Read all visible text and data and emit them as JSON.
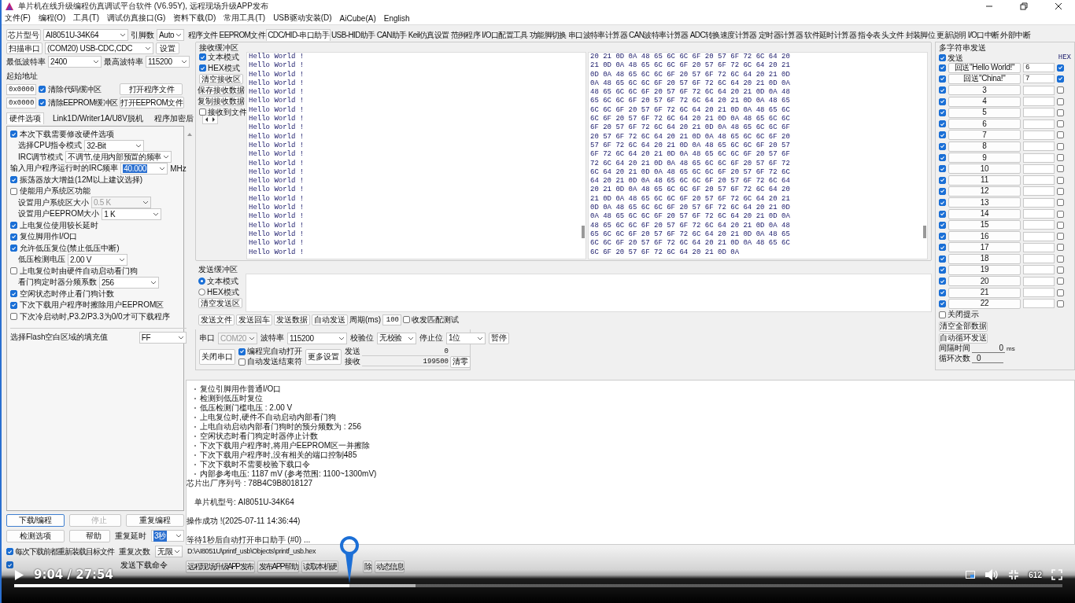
{
  "window": {
    "title": "单片机在线升级编程仿真调试平台软件 (V6.95Y), 远程现场升级APP发布"
  },
  "menu": [
    "文件(F)",
    "编程(O)",
    "工具(T)",
    "调试仿真接口(G)",
    "资料下载(D)",
    "常用工具(T)",
    "USB驱动安装(D)",
    "AiCube(A)",
    "English"
  ],
  "chip": {
    "label": "芯片型号",
    "value": "AI8051U-34K64",
    "pins_label": "引脚数",
    "pins_value": "Auto"
  },
  "port": {
    "button": "扫描串口",
    "value": "(COM20) USB-CDC,CDC",
    "settings_button": "设置"
  },
  "baud": {
    "min_label": "最低波特率",
    "min_value": "2400",
    "max_label": "最高波特率",
    "max_value": "115200"
  },
  "start_address": {
    "label": "起始地址",
    "rows": [
      {
        "address": "0x0000",
        "label": "清除代码缓冲区",
        "checked": true,
        "button": "打开程序文件"
      },
      {
        "address": "0x0000",
        "label": "清除EEPROM缓冲区",
        "checked": true,
        "button": "打开EEPROM文件"
      }
    ]
  },
  "left_tabs": [
    {
      "label": "硬件选项",
      "selected": true
    },
    {
      "label": "Link1D/Writer1A/U8V脱机",
      "selected": false
    },
    {
      "label": "程序加密后",
      "selected": false
    }
  ],
  "hardware_options": [
    {
      "kind": "check",
      "label": "本次下载需要修改硬件选项",
      "checked": true
    },
    {
      "kind": "select",
      "label": "选择CPU指令模式",
      "value": "32-Bit",
      "disabled": false
    },
    {
      "kind": "select",
      "label": "IRC调节模式",
      "value": "不调节,使用内部预置的频率",
      "disabled": false
    },
    {
      "kind": "input",
      "label": "输入用户程序运行时的IRC频率",
      "value": "40.000",
      "unit": "MHz"
    },
    {
      "kind": "check",
      "label": "振荡器放大增益(12M以上建议选择)",
      "checked": true
    },
    {
      "kind": "check",
      "label": "使能用户系统区功能",
      "checked": false
    },
    {
      "kind": "select",
      "label": "设置用户系统区大小",
      "value": "0.5 K",
      "disabled": true
    },
    {
      "kind": "select",
      "label": "设置用户EEPROM大小",
      "value": "1  K",
      "disabled": false
    },
    {
      "kind": "check",
      "label": "上电复位使用较长延时",
      "checked": true
    },
    {
      "kind": "check",
      "label": "复位脚用作I/O口",
      "checked": true
    },
    {
      "kind": "check",
      "label": "允许低压复位(禁止低压中断)",
      "checked": true
    },
    {
      "kind": "select",
      "label": "低压检测电压",
      "value": "2.00 V",
      "disabled": false
    },
    {
      "kind": "check",
      "label": "上电复位时由硬件自动启动看门狗",
      "checked": false
    },
    {
      "kind": "select",
      "label": "看门狗定时器分频系数",
      "value": "256",
      "disabled": false
    },
    {
      "kind": "check",
      "label": "空闲状态时停止看门狗计数",
      "checked": true
    },
    {
      "kind": "check",
      "label": "下次下载用户程序时擦除用户EEPROM区",
      "checked": true
    },
    {
      "kind": "check",
      "label": "下次冷启动时,P3.2/P3.3为0/0才可下载程序",
      "checked": false
    },
    {
      "kind": "fill",
      "label": "选择Flash空白区域的填充值",
      "value": "FF"
    }
  ],
  "program_buttons": {
    "download": "下载/编程",
    "stop": "停止",
    "repeat": "重复编程",
    "check": "检测选项",
    "help": "帮助",
    "delay_label": "重复延时",
    "delay_value": "3秒",
    "count_label": "重复次数",
    "count_value": "无限"
  },
  "reload_checks": [
    {
      "label": "每次下载前都重新装载目标文件",
      "checked": true
    },
    {
      "label": "发送下载命令",
      "checked": true
    }
  ],
  "tabs": [
    {
      "label": "程序文件",
      "selected": false
    },
    {
      "label": "EEPROM文件",
      "selected": false
    },
    {
      "label": "CDC/HID-串口助手",
      "selected": true
    },
    {
      "label": "USB-HID助手",
      "selected": false
    },
    {
      "label": "CAN助手",
      "selected": false
    },
    {
      "label": "Keil仿真设置",
      "selected": false
    },
    {
      "label": "范例程序",
      "selected": false
    },
    {
      "label": "I/O口配置工具",
      "selected": false
    },
    {
      "label": "功能脚切换",
      "selected": false
    },
    {
      "label": "串口波特率计算器",
      "selected": false
    },
    {
      "label": "CAN波特率计算器",
      "selected": false
    },
    {
      "label": "ADC转换速度计算器",
      "selected": false
    },
    {
      "label": "定时器计算器",
      "selected": false
    },
    {
      "label": "软件延时计算器",
      "selected": false
    },
    {
      "label": "指令表",
      "selected": false
    },
    {
      "label": "头文件",
      "selected": false
    },
    {
      "label": "封装脚位",
      "selected": false
    },
    {
      "label": "更新说明",
      "selected": false
    },
    {
      "label": "I/O口中断",
      "selected": false
    },
    {
      "label": "外部中断",
      "selected": false
    }
  ],
  "receive": {
    "title": "接收缓冲区",
    "text_mode": {
      "label": "文本模式",
      "checked": true
    },
    "hex_mode": {
      "label": "HEX模式",
      "checked": true
    },
    "buttons": [
      "清空接收区",
      "保存接收数据",
      "复制接收数据"
    ],
    "to_file": {
      "label": "接收到文件",
      "checked": false
    },
    "text_lines": [
      "Hello World !",
      "Hello World !",
      "Hello World !",
      "Hello World !",
      "Hello World !",
      "Hello World !",
      "Hello World !",
      "Hello World !",
      "Hello World !",
      "Hello World !",
      "Hello World !",
      "Hello World !",
      "Hello World !",
      "Hello World !",
      "Hello World !",
      "Hello World !",
      "Hello World !",
      "Hello World !",
      "Hello World !",
      "Hello World !",
      "Hello World !",
      "Hello World !",
      "Hello World !"
    ],
    "hex_lines": [
      "20 21 0D 0A 48 65 6C 6C 6F 20 57 6F 72 6C 64 20",
      "21 0D 0A 48 65 6C 6C 6F 20 57 6F 72 6C 64 20 21",
      "0D 0A 48 65 6C 6C 6F 20 57 6F 72 6C 64 20 21 0D",
      "0A 48 65 6C 6C 6F 20 57 6F 72 6C 64 20 21 0D 0A",
      "48 65 6C 6C 6F 20 57 6F 72 6C 64 20 21 0D 0A 48",
      "65 6C 6C 6F 20 57 6F 72 6C 64 20 21 0D 0A 48 65",
      "6C 6C 6F 20 57 6F 72 6C 64 20 21 0D 0A 48 65 6C",
      "6C 6F 20 57 6F 72 6C 64 20 21 0D 0A 48 65 6C 6C",
      "6F 20 57 6F 72 6C 64 20 21 0D 0A 48 65 6C 6C 6F",
      "20 57 6F 72 6C 64 20 21 0D 0A 48 65 6C 6C 6F 20",
      "57 6F 72 6C 64 20 21 0D 0A 48 65 6C 6C 6F 20 57",
      "6F 72 6C 64 20 21 0D 0A 48 65 6C 6C 6F 20 57 6F",
      "72 6C 64 20 21 0D 0A 48 65 6C 6C 6F 20 57 6F 72",
      "6C 64 20 21 0D 0A 48 65 6C 6C 6F 20 57 6F 72 6C",
      "64 20 21 0D 0A 48 65 6C 6C 6F 20 57 6F 72 6C 64",
      "20 21 0D 0A 48 65 6C 6C 6F 20 57 6F 72 6C 64 20",
      "21 0D 0A 48 65 6C 6C 6F 20 57 6F 72 6C 64 20 21",
      "0D 0A 48 65 6C 6C 6F 20 57 6F 72 6C 64 20 21 0D",
      "0A 48 65 6C 6C 6F 20 57 6F 72 6C 64 20 21 0D 0A",
      "48 65 6C 6C 6F 20 57 6F 72 6C 64 20 21 0D 0A 48",
      "65 6C 6C 6F 20 57 6F 72 6C 64 20 21 0D 0A 48 65",
      "6C 6C 6F 20 57 6F 72 6C 64 20 21 0D 0A 48 65 6C",
      "6C 6F 20 57 6F 72 6C 64 20 21 0D 0A"
    ]
  },
  "send": {
    "title": "发送缓冲区",
    "modes": [
      {
        "label": "文本模式",
        "selected": true
      },
      {
        "label": "HEX模式",
        "selected": false
      }
    ],
    "clear_button": "清空发送区",
    "actions": [
      "发送文件",
      "发送回车",
      "发送数据",
      "自动发送"
    ],
    "period_label": "周期(ms)",
    "period_value": "100",
    "match_test": {
      "label": "收发匹配测试",
      "checked": false
    }
  },
  "serial": {
    "port_label": "串口",
    "port_value": "COM20",
    "baud_label": "波特率",
    "baud_value": "115200",
    "parity_label": "校验位",
    "parity_value": "无校验",
    "stop_label": "停止位",
    "stop_value": "1位",
    "pause_button": "暂停",
    "close_button": "关闭串口",
    "auto_open": {
      "label": "编程完自动打开",
      "checked": true
    },
    "auto_end": {
      "label": "自动发送结束符",
      "checked": false
    },
    "more_button": "更多设置",
    "sent_label": "发送",
    "sent_value": "0",
    "received_label": "接收",
    "received_value": "199500",
    "clear_button": "清零"
  },
  "multi_send": {
    "title": "多字符串发送",
    "send_all": {
      "label": "发送",
      "checked": true
    },
    "hex_label": "HEX",
    "rows": [
      {
        "send": true,
        "label": "回送\"Hello World!\"",
        "value": "6",
        "hex": true
      },
      {
        "send": true,
        "label": "回送\"China!\"",
        "value": "7",
        "hex": true
      },
      {
        "send": true,
        "label": "3",
        "hex": false
      },
      {
        "send": true,
        "label": "4",
        "hex": false
      },
      {
        "send": true,
        "label": "5",
        "hex": false
      },
      {
        "send": true,
        "label": "6",
        "hex": false
      },
      {
        "send": true,
        "label": "7",
        "hex": false
      },
      {
        "send": true,
        "label": "8",
        "hex": false
      },
      {
        "send": true,
        "label": "9",
        "hex": false
      },
      {
        "send": true,
        "label": "10",
        "hex": false
      },
      {
        "send": true,
        "label": "11",
        "hex": false
      },
      {
        "send": true,
        "label": "12",
        "hex": false
      },
      {
        "send": true,
        "label": "13",
        "hex": false
      },
      {
        "send": true,
        "label": "14",
        "hex": false
      },
      {
        "send": true,
        "label": "15",
        "hex": false
      },
      {
        "send": true,
        "label": "16",
        "hex": false
      },
      {
        "send": true,
        "label": "17",
        "hex": false
      },
      {
        "send": true,
        "label": "18",
        "hex": false
      },
      {
        "send": true,
        "label": "19",
        "hex": false
      },
      {
        "send": true,
        "label": "20",
        "hex": false
      },
      {
        "send": true,
        "label": "21",
        "hex": false
      },
      {
        "send": true,
        "label": "22",
        "hex": false
      }
    ],
    "close_tips": {
      "label": "关闭提示",
      "checked": false
    },
    "clear_button": "清空全部数据",
    "loop_button": "自动循环发送",
    "interval_label": "间隔时间",
    "interval_value": "0",
    "interval_unit": "ms",
    "loop_label": "循环次数",
    "loop_value": "0"
  },
  "log": [
    {
      "kind": "detail",
      "text": "复位引脚用作普通I/O口"
    },
    {
      "kind": "detail",
      "text": "检测到低压时复位"
    },
    {
      "kind": "detail",
      "text": "低压检测门槛电压 : 2.00 V"
    },
    {
      "kind": "detail",
      "text": "上电复位时,硬件不自动启动内部看门狗"
    },
    {
      "kind": "detail",
      "text": "上电自动启动内部看门狗时的预分频数为 : 256"
    },
    {
      "kind": "detail",
      "text": "空闲状态时看门狗定时器停止计数"
    },
    {
      "kind": "detail",
      "text": "下次下载用户程序时,将用户EEPROM区一并擦除"
    },
    {
      "kind": "detail",
      "text": "下次下载用户程序时,没有相关的端口控制485"
    },
    {
      "kind": "detail",
      "text": "下次下载时不需要校验下载口令"
    },
    {
      "kind": "detail",
      "text": "内部参考电压: 1187 mV (参考范围: 1100~1300mV)"
    },
    {
      "kind": "plain",
      "text": "芯片出厂序列号 : 78B4C9B8018127"
    },
    {
      "kind": "blank"
    },
    {
      "kind": "indent",
      "text": "单片机型号: AI8051U-34K64"
    },
    {
      "kind": "blank"
    },
    {
      "kind": "plain",
      "text": "操作成功 !(2025-07-11 14:36:44)"
    },
    {
      "kind": "blank"
    },
    {
      "kind": "plain",
      "text": "等待1秒后自动打开串口助手 (#0) ..."
    }
  ],
  "file_path": "D:\\AI8051U\\printf_usb\\Objects\\printf_usb.hex",
  "bottom_buttons": [
    "远程现场升级APP发布",
    "发布APP帮助",
    "读取本机硬",
    "除",
    "动态信息"
  ],
  "video": {
    "time": "9:04 / 27:54",
    "playing": false,
    "progress": {
      "level": 0.32
    },
    "buffered": {
      "level": 0.383
    },
    "quality": "612"
  }
}
